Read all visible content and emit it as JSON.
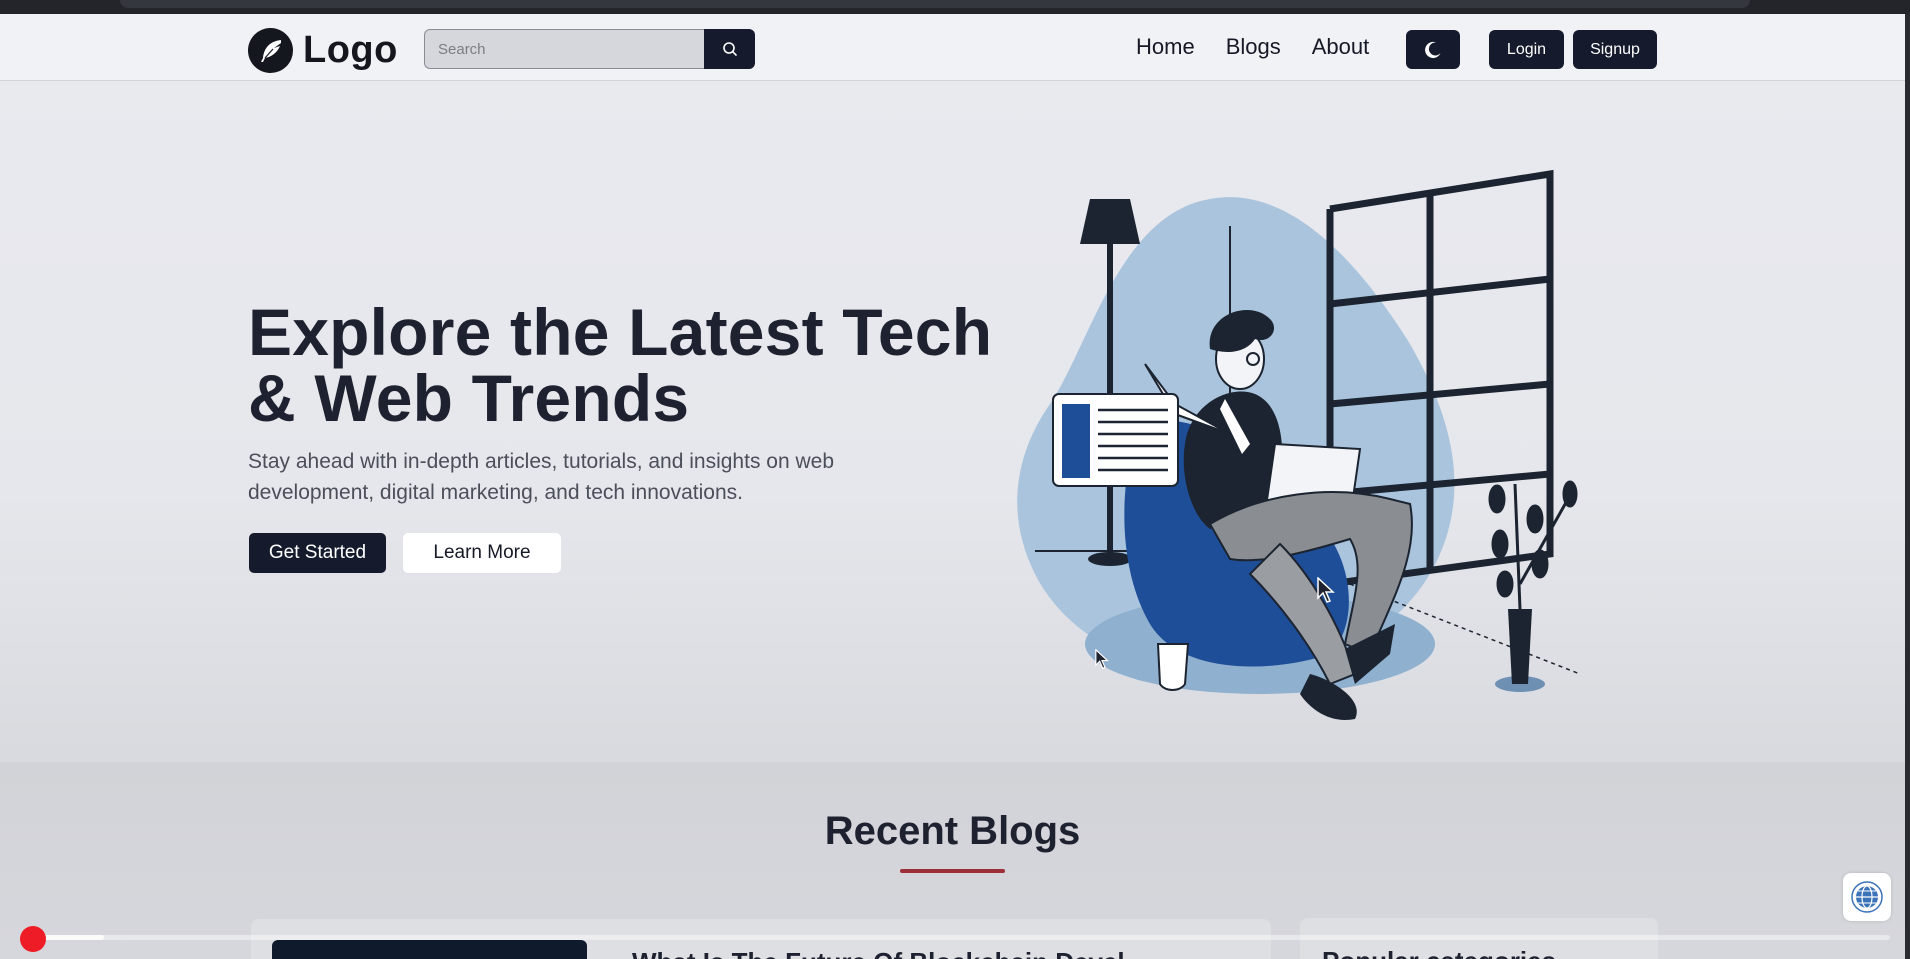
{
  "navbar": {
    "logo_text": "Logo",
    "search_placeholder": "Search",
    "links": [
      "Home",
      "Blogs",
      "About"
    ],
    "login_label": "Login",
    "signup_label": "Signup"
  },
  "hero": {
    "title": "Explore the Latest Tech & Web Trends",
    "subtitle": "Stay ahead with in-depth articles, tutorials, and insights on web development, digital marketing, and tech innovations.",
    "primary_button": "Get Started",
    "secondary_button": "Learn More"
  },
  "recent": {
    "title": "Recent Blogs",
    "first_blog_title": "What Is The Future Of Blockchain Devel...",
    "categories_title": "Popular categories"
  },
  "icons": {
    "logo": "feather-icon",
    "search": "search-icon",
    "theme": "moon-icon",
    "badge": "globe-icon"
  },
  "colors": {
    "primary": "#151a2c",
    "accent_underline": "#9d2f38",
    "video_dot": "#ee1c26",
    "illustration_blue": "#1f4e99",
    "illustration_light_blue": "#a9c4dc"
  },
  "video": {
    "progress": 0.04
  }
}
